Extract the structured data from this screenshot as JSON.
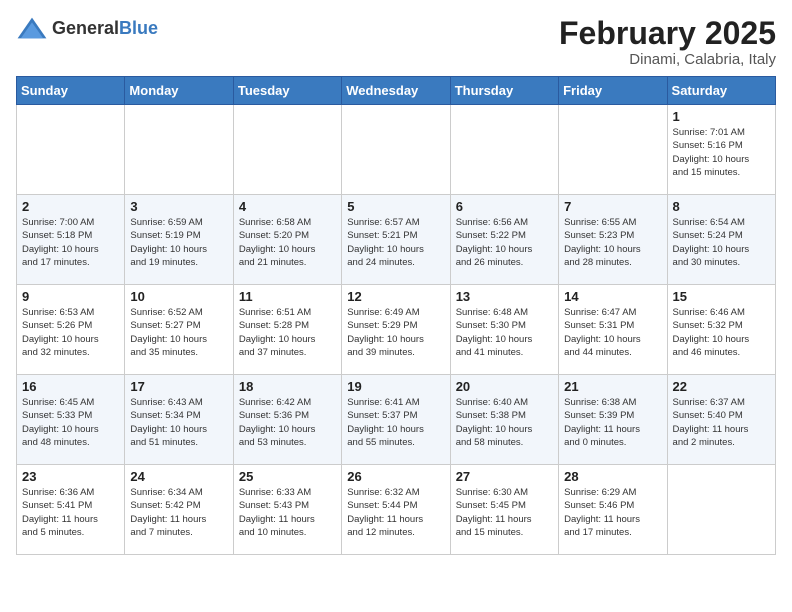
{
  "header": {
    "logo": {
      "general": "General",
      "blue": "Blue"
    },
    "month_year": "February 2025",
    "location": "Dinami, Calabria, Italy"
  },
  "days_of_week": [
    "Sunday",
    "Monday",
    "Tuesday",
    "Wednesday",
    "Thursday",
    "Friday",
    "Saturday"
  ],
  "weeks": [
    [
      {
        "day": "",
        "info": ""
      },
      {
        "day": "",
        "info": ""
      },
      {
        "day": "",
        "info": ""
      },
      {
        "day": "",
        "info": ""
      },
      {
        "day": "",
        "info": ""
      },
      {
        "day": "",
        "info": ""
      },
      {
        "day": "1",
        "info": "Sunrise: 7:01 AM\nSunset: 5:16 PM\nDaylight: 10 hours\nand 15 minutes."
      }
    ],
    [
      {
        "day": "2",
        "info": "Sunrise: 7:00 AM\nSunset: 5:18 PM\nDaylight: 10 hours\nand 17 minutes."
      },
      {
        "day": "3",
        "info": "Sunrise: 6:59 AM\nSunset: 5:19 PM\nDaylight: 10 hours\nand 19 minutes."
      },
      {
        "day": "4",
        "info": "Sunrise: 6:58 AM\nSunset: 5:20 PM\nDaylight: 10 hours\nand 21 minutes."
      },
      {
        "day": "5",
        "info": "Sunrise: 6:57 AM\nSunset: 5:21 PM\nDaylight: 10 hours\nand 24 minutes."
      },
      {
        "day": "6",
        "info": "Sunrise: 6:56 AM\nSunset: 5:22 PM\nDaylight: 10 hours\nand 26 minutes."
      },
      {
        "day": "7",
        "info": "Sunrise: 6:55 AM\nSunset: 5:23 PM\nDaylight: 10 hours\nand 28 minutes."
      },
      {
        "day": "8",
        "info": "Sunrise: 6:54 AM\nSunset: 5:24 PM\nDaylight: 10 hours\nand 30 minutes."
      }
    ],
    [
      {
        "day": "9",
        "info": "Sunrise: 6:53 AM\nSunset: 5:26 PM\nDaylight: 10 hours\nand 32 minutes."
      },
      {
        "day": "10",
        "info": "Sunrise: 6:52 AM\nSunset: 5:27 PM\nDaylight: 10 hours\nand 35 minutes."
      },
      {
        "day": "11",
        "info": "Sunrise: 6:51 AM\nSunset: 5:28 PM\nDaylight: 10 hours\nand 37 minutes."
      },
      {
        "day": "12",
        "info": "Sunrise: 6:49 AM\nSunset: 5:29 PM\nDaylight: 10 hours\nand 39 minutes."
      },
      {
        "day": "13",
        "info": "Sunrise: 6:48 AM\nSunset: 5:30 PM\nDaylight: 10 hours\nand 41 minutes."
      },
      {
        "day": "14",
        "info": "Sunrise: 6:47 AM\nSunset: 5:31 PM\nDaylight: 10 hours\nand 44 minutes."
      },
      {
        "day": "15",
        "info": "Sunrise: 6:46 AM\nSunset: 5:32 PM\nDaylight: 10 hours\nand 46 minutes."
      }
    ],
    [
      {
        "day": "16",
        "info": "Sunrise: 6:45 AM\nSunset: 5:33 PM\nDaylight: 10 hours\nand 48 minutes."
      },
      {
        "day": "17",
        "info": "Sunrise: 6:43 AM\nSunset: 5:34 PM\nDaylight: 10 hours\nand 51 minutes."
      },
      {
        "day": "18",
        "info": "Sunrise: 6:42 AM\nSunset: 5:36 PM\nDaylight: 10 hours\nand 53 minutes."
      },
      {
        "day": "19",
        "info": "Sunrise: 6:41 AM\nSunset: 5:37 PM\nDaylight: 10 hours\nand 55 minutes."
      },
      {
        "day": "20",
        "info": "Sunrise: 6:40 AM\nSunset: 5:38 PM\nDaylight: 10 hours\nand 58 minutes."
      },
      {
        "day": "21",
        "info": "Sunrise: 6:38 AM\nSunset: 5:39 PM\nDaylight: 11 hours\nand 0 minutes."
      },
      {
        "day": "22",
        "info": "Sunrise: 6:37 AM\nSunset: 5:40 PM\nDaylight: 11 hours\nand 2 minutes."
      }
    ],
    [
      {
        "day": "23",
        "info": "Sunrise: 6:36 AM\nSunset: 5:41 PM\nDaylight: 11 hours\nand 5 minutes."
      },
      {
        "day": "24",
        "info": "Sunrise: 6:34 AM\nSunset: 5:42 PM\nDaylight: 11 hours\nand 7 minutes."
      },
      {
        "day": "25",
        "info": "Sunrise: 6:33 AM\nSunset: 5:43 PM\nDaylight: 11 hours\nand 10 minutes."
      },
      {
        "day": "26",
        "info": "Sunrise: 6:32 AM\nSunset: 5:44 PM\nDaylight: 11 hours\nand 12 minutes."
      },
      {
        "day": "27",
        "info": "Sunrise: 6:30 AM\nSunset: 5:45 PM\nDaylight: 11 hours\nand 15 minutes."
      },
      {
        "day": "28",
        "info": "Sunrise: 6:29 AM\nSunset: 5:46 PM\nDaylight: 11 hours\nand 17 minutes."
      },
      {
        "day": "",
        "info": ""
      }
    ]
  ]
}
